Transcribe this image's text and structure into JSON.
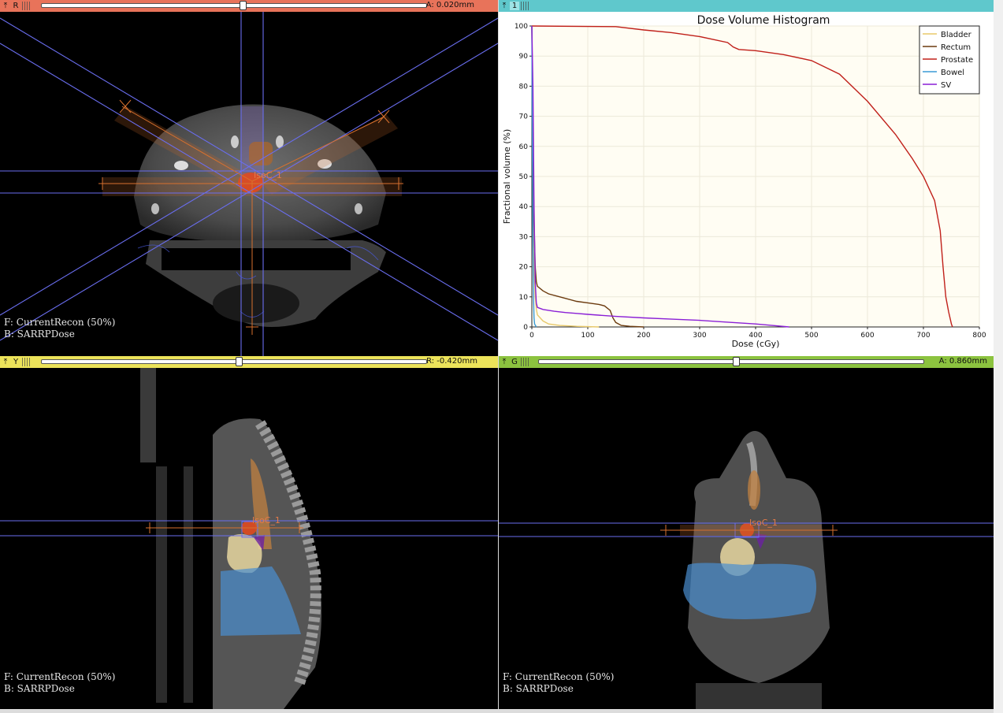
{
  "views": {
    "red": {
      "bar_label": "R",
      "offset": "A: 0.020mm",
      "slider_fraction": 0.52,
      "fg": "F: CurrentRecon (50%)",
      "bg": "B: SARRPDose",
      "color": "#e8735a"
    },
    "chart": {
      "bar_label": "1",
      "color": "#5fc8cc"
    },
    "yellow": {
      "bar_label": "Y",
      "offset": "R: -0.420mm",
      "slider_fraction": 0.51,
      "fg": "F: CurrentRecon (50%)",
      "bg": "B: SARRPDose",
      "color": "#ece35a",
      "isocenter_label": "IsoC_1"
    },
    "green": {
      "bar_label": "G",
      "offset": "A: 0.860mm",
      "slider_fraction": 0.51,
      "fg": "F: CurrentRecon (50%)",
      "bg": "B: SARRPDose",
      "color": "#8cc33f",
      "isocenter_label": "IsoC_1"
    },
    "red_isocenter_label": "IsoC_1"
  },
  "icons": {
    "pin": "pin-icon",
    "link": "link-icon"
  },
  "chart_data": {
    "type": "line",
    "title": "Dose Volume Histogram",
    "xlabel": "Dose (cGy)",
    "ylabel": "Fractional volume (%)",
    "xlim": [
      0,
      800
    ],
    "ylim": [
      0,
      100
    ],
    "xticks": [
      0,
      100,
      200,
      300,
      400,
      500,
      600,
      700,
      800
    ],
    "yticks": [
      0,
      10,
      20,
      30,
      40,
      50,
      60,
      70,
      80,
      90,
      100
    ],
    "grid": true,
    "legend_position": "top-right",
    "series": [
      {
        "name": "Bladder",
        "color": "#e8c96a",
        "x": [
          0,
          2,
          4,
          6,
          8,
          10,
          20,
          30,
          50,
          80,
          120
        ],
        "y": [
          100,
          55,
          20,
          10,
          6,
          4,
          2,
          1,
          0.5,
          0.2,
          0
        ]
      },
      {
        "name": "Rectum",
        "color": "#6b3a0e",
        "x": [
          0,
          2,
          4,
          6,
          8,
          10,
          20,
          30,
          50,
          80,
          100,
          120,
          130,
          140,
          145,
          150,
          160,
          175,
          200
        ],
        "y": [
          100,
          60,
          35,
          20,
          15,
          13.5,
          12,
          11,
          10,
          8.5,
          8,
          7.5,
          7,
          5.5,
          3,
          1.5,
          0.5,
          0.2,
          0
        ]
      },
      {
        "name": "Prostate",
        "color": "#c0201a",
        "x": [
          0,
          150,
          200,
          250,
          300,
          350,
          360,
          370,
          400,
          450,
          500,
          550,
          600,
          650,
          680,
          700,
          720,
          730,
          735,
          740,
          745,
          750,
          752
        ],
        "y": [
          100,
          99.8,
          98.7,
          97.8,
          96.5,
          94.5,
          93,
          92.2,
          91.8,
          90.5,
          88.5,
          84,
          75,
          64,
          56,
          50,
          42,
          32,
          20,
          10,
          5,
          1,
          0
        ]
      },
      {
        "name": "Bowel",
        "color": "#3a9ad6",
        "x": [
          0,
          1,
          2,
          3,
          4,
          5,
          8
        ],
        "y": [
          100,
          60,
          30,
          10,
          3,
          1,
          0
        ]
      },
      {
        "name": "SV",
        "color": "#8a1fd6",
        "x": [
          0,
          2,
          4,
          6,
          8,
          10,
          20,
          40,
          60,
          80,
          100,
          150,
          200,
          250,
          300,
          350,
          400,
          430,
          460
        ],
        "y": [
          100,
          80,
          40,
          15,
          8,
          6.5,
          5.8,
          5.2,
          4.8,
          4.5,
          4.2,
          3.5,
          3,
          2.6,
          2.2,
          1.6,
          1.0,
          0.5,
          0
        ]
      }
    ]
  }
}
